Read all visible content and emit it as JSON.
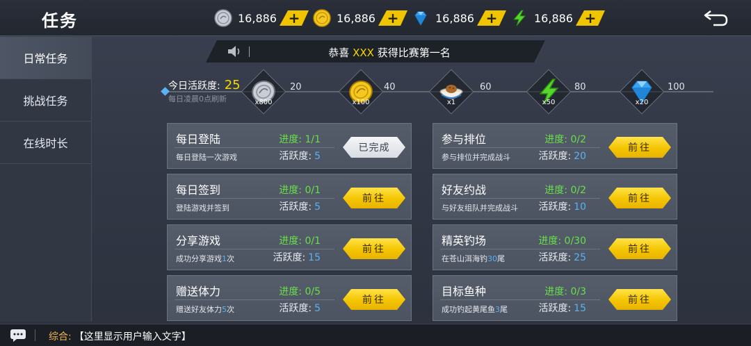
{
  "header": {
    "title": "任务",
    "currencies": [
      {
        "icon": "silver-coin-icon",
        "amount": "16,886"
      },
      {
        "icon": "gold-coin-icon",
        "amount": "16,886"
      },
      {
        "icon": "diamond-icon",
        "amount": "16,886"
      },
      {
        "icon": "lightning-icon",
        "amount": "16,886"
      }
    ],
    "plus_label": "+"
  },
  "sidebar": {
    "items": [
      {
        "label": "日常任务",
        "active": true
      },
      {
        "label": "挑战任务",
        "active": false
      },
      {
        "label": "在线时长",
        "active": false
      }
    ]
  },
  "announcement": {
    "prefix": "恭喜",
    "highlight": "XXX",
    "suffix": "获得比赛第一名"
  },
  "activity": {
    "label": "今日活跃度:",
    "value": "25",
    "reset_note": "每日凌晨0点刷新",
    "rewards": [
      {
        "icon": "silver-coin-icon",
        "qty": "x800",
        "threshold": "20"
      },
      {
        "icon": "gold-coin-icon",
        "qty": "x100",
        "threshold": "40"
      },
      {
        "icon": "food-bowl-icon",
        "qty": "x1",
        "threshold": "60"
      },
      {
        "icon": "lightning-icon",
        "qty": "x50",
        "threshold": "80"
      },
      {
        "icon": "diamond-icon",
        "qty": "x20",
        "threshold": "100"
      }
    ]
  },
  "tasks": [
    {
      "name": "每日登陆",
      "desc_pre": "每日登陆一次游戏",
      "desc_num": "",
      "desc_post": "",
      "progress": "进度: 1/1",
      "act_label": "活跃度:",
      "act_value": "5",
      "button": "已完成",
      "done": true
    },
    {
      "name": "参与排位",
      "desc_pre": "参与排位并完成战斗",
      "desc_num": "",
      "desc_post": "",
      "progress": "进度: 0/2",
      "act_label": "活跃度:",
      "act_value": "20",
      "button": "前往",
      "done": false
    },
    {
      "name": "每日签到",
      "desc_pre": "登陆游戏并签到",
      "desc_num": "",
      "desc_post": "",
      "progress": "进度: 0/1",
      "act_label": "活跃度:",
      "act_value": "5",
      "button": "前往",
      "done": false
    },
    {
      "name": "好友约战",
      "desc_pre": "与好友组队并完成战斗",
      "desc_num": "",
      "desc_post": "",
      "progress": "进度: 0/2",
      "act_label": "活跃度:",
      "act_value": "10",
      "button": "前往",
      "done": false
    },
    {
      "name": "分享游戏",
      "desc_pre": "成功分享游戏",
      "desc_num": "1",
      "desc_post": "次",
      "progress": "进度: 0/1",
      "act_label": "活跃度:",
      "act_value": "15",
      "button": "前往",
      "done": false
    },
    {
      "name": "精英钓场",
      "desc_pre": "在苍山洱海钓",
      "desc_num": "30",
      "desc_post": "尾",
      "progress": "进度: 0/30",
      "act_label": "活跃度:",
      "act_value": "25",
      "button": "前往",
      "done": false
    },
    {
      "name": "赠送体力",
      "desc_pre": "赠送好友体力",
      "desc_num": "5",
      "desc_post": "次",
      "progress": "进度: 0/5",
      "act_label": "活跃度:",
      "act_value": "5",
      "button": "前往",
      "done": false
    },
    {
      "name": "目标鱼种",
      "desc_pre": "成功钓起黄尾鱼",
      "desc_num": "3",
      "desc_post": "尾",
      "progress": "进度: 0/3",
      "act_label": "活跃度:",
      "act_value": "15",
      "button": "前往",
      "done": false
    }
  ],
  "chat": {
    "channel": "综合:",
    "message": "【这里显示用户输入文字】"
  },
  "colors": {
    "accent_yellow": "#f4c500",
    "progress_green": "#67e04a",
    "value_blue": "#5ab3f2",
    "highlight_yellow": "#f7d900"
  }
}
